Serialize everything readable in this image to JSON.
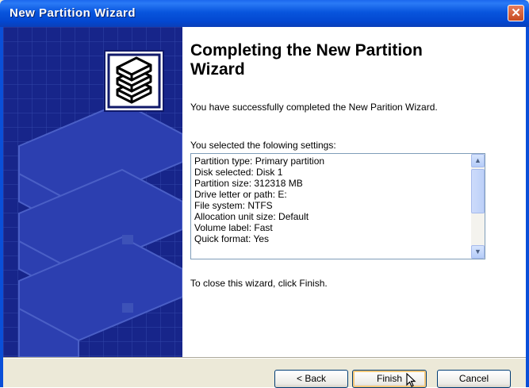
{
  "window": {
    "title": "New Partition Wizard",
    "close_glyph": "✕"
  },
  "main": {
    "heading_line1": "Completing the New Partition",
    "heading_line2": "Wizard",
    "success_message": "You have successfully completed the New Parition Wizard.",
    "settings_label": "You selected the folowing settings:",
    "settings": [
      "Partition type: Primary partition",
      "Disk selected: Disk 1",
      "Partition size: 312318 MB",
      "Drive letter or path: E:",
      "File system: NTFS",
      "Allocation unit size: Default",
      "Volume label: Fast",
      "Quick format: Yes"
    ],
    "close_hint": "To close this wizard, click Finish."
  },
  "buttons": {
    "back": "< Back",
    "finish": "Finish",
    "cancel": "Cancel"
  },
  "icons": {
    "wizard_icon": "stacked-disks-icon",
    "close": "close-icon",
    "scroll_up": "scroll-up-icon",
    "scroll_down": "scroll-down-icon",
    "cursor": "mouse-cursor-icon"
  },
  "colors": {
    "titlebar": "#0855dd",
    "side_panel": "#1a2a8c",
    "close_button": "#c74b20",
    "window_face": "#ece9d8"
  }
}
